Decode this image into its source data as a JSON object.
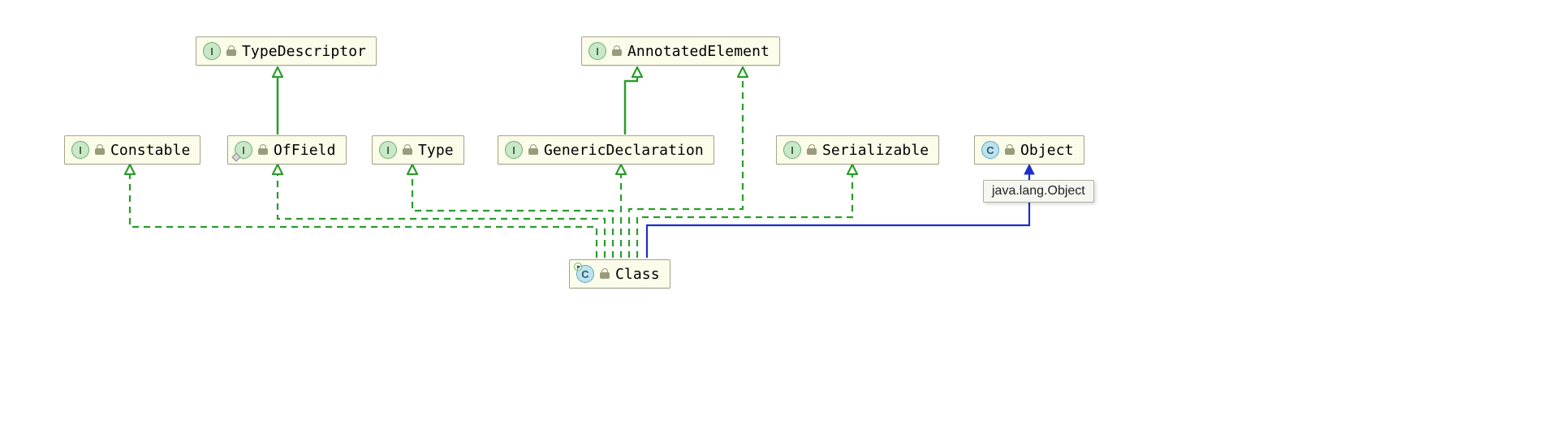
{
  "nodes": {
    "typedescriptor": {
      "label": "TypeDescriptor",
      "kind_letter": "I"
    },
    "annotatedelement": {
      "label": "AnnotatedElement",
      "kind_letter": "I"
    },
    "constable": {
      "label": "Constable",
      "kind_letter": "I"
    },
    "offield": {
      "label": "OfField",
      "kind_letter": "I"
    },
    "type": {
      "label": "Type",
      "kind_letter": "I"
    },
    "genericdeclaration": {
      "label": "GenericDeclaration",
      "kind_letter": "I"
    },
    "serializable": {
      "label": "Serializable",
      "kind_letter": "I"
    },
    "object": {
      "label": "Object",
      "kind_letter": "C"
    },
    "class": {
      "label": "Class",
      "kind_letter": "C"
    }
  },
  "tooltip": {
    "text": "java.lang.Object"
  },
  "colors": {
    "implements": "#2a9d2a",
    "extends": "#1c2ec8"
  }
}
